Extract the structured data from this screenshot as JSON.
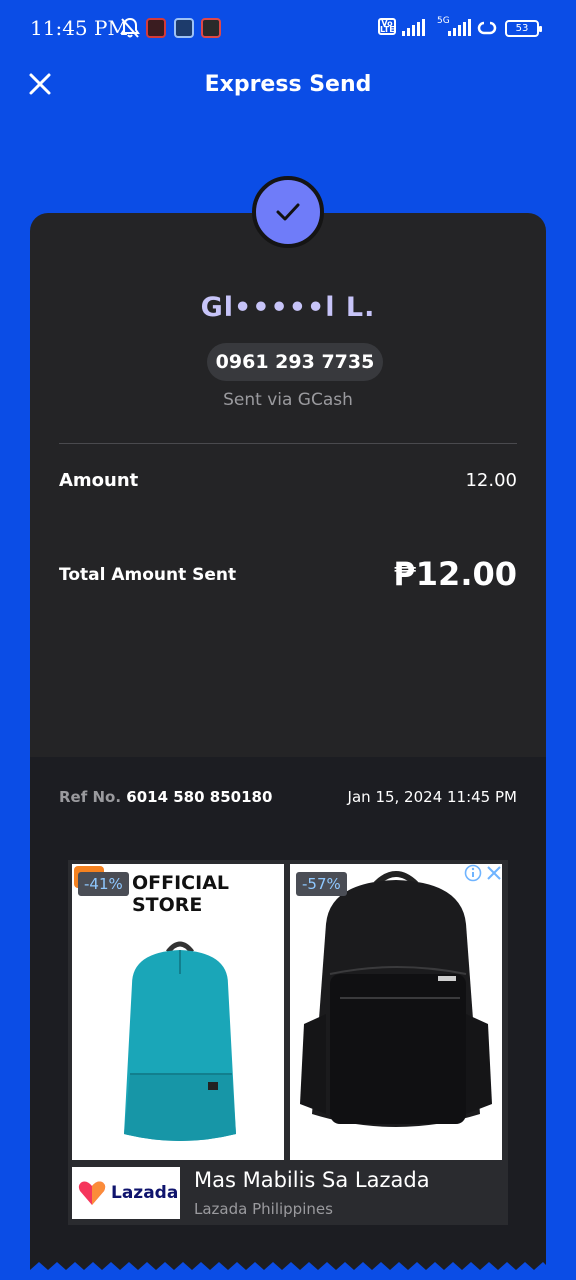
{
  "status_bar": {
    "time": "11:45 PM",
    "network": "5G",
    "battery": "53"
  },
  "header": {
    "title": "Express Send"
  },
  "receipt": {
    "recipient_name": "Gl•••••l L.",
    "phone": "0961 293 7735",
    "sent_via": "Sent via GCash",
    "amount_label": "Amount",
    "amount_value": "12.00",
    "total_label": "Total Amount Sent",
    "total_value": "₱12.00",
    "ref_label": "Ref No.",
    "ref_number": "6014 580 850180",
    "date": "Jan 15, 2024 11:45 PM"
  },
  "ad": {
    "product_1": {
      "discount": "-41%",
      "store_text": "OFFICIAL STORE"
    },
    "product_2": {
      "discount": "-57%"
    },
    "brand": "Lazada",
    "headline": "Mas Mabilis Sa Lazada",
    "advertiser": "Lazada Philippines"
  },
  "colors": {
    "brand_blue": "#0b4de6",
    "card": "#242426",
    "accent_purple": "#6f7cf9",
    "name_lavender": "#c7c4f8"
  }
}
